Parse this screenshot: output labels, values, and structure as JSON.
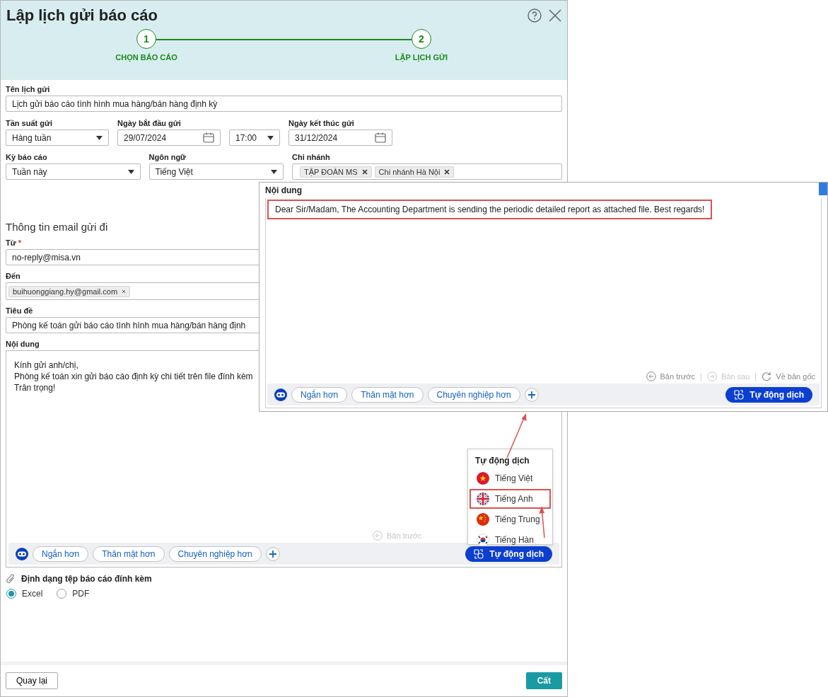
{
  "dialog": {
    "title": "Lập lịch gửi báo cáo"
  },
  "steps": [
    {
      "number": "1",
      "label": "CHỌN BÁO CÁO"
    },
    {
      "number": "2",
      "label": "LẬP LỊCH GỬI"
    }
  ],
  "schedule": {
    "name": {
      "label": "Tên lịch gửi",
      "value": "Lịch gửi báo cáo tình hình mua hàng/bán hàng định kỳ"
    },
    "frequency": {
      "label": "Tần suất gửi",
      "value": "Hàng tuần"
    },
    "start": {
      "label": "Ngày bắt đầu gửi",
      "date": "29/07/2024",
      "time": "17:00"
    },
    "end": {
      "label": "Ngày kết thúc gửi",
      "date": "31/12/2024"
    },
    "period": {
      "label": "Kỳ báo cáo",
      "value": "Tuần này"
    },
    "language": {
      "label": "Ngôn ngữ",
      "value": "Tiếng Việt"
    },
    "branch": {
      "label": "Chi nhánh",
      "tags": [
        "TẬP ĐOÀN MS",
        "Chi nhánh Hà Nội"
      ]
    }
  },
  "email": {
    "heading": "Thông tin email gửi đi",
    "from": {
      "label": "Từ",
      "required_mark": "*",
      "value": "no-reply@misa.vn"
    },
    "to": {
      "label": "Đến",
      "tags": [
        "buihuonggiang.hy@gmail.com"
      ]
    },
    "subject": {
      "label": "Tiêu đề",
      "value": "Phòng kế toán gửi báo cáo tình hình mua hàng/bán hàng định"
    },
    "content": {
      "label": "Nội dung",
      "lines": [
        "Kính gửi anh/chị,",
        "Phòng kế toán xin gửi báo cáo định kỳ chi tiết trên file đính kèm",
        "Trân trọng!"
      ],
      "nav": [
        {
          "label": "Bản trước",
          "kind": "back",
          "disabled": true
        }
      ],
      "chips": [
        "Ngắn hơn",
        "Thân mật hơn",
        "Chuyên nghiệp hơn"
      ],
      "translate_button": "Tự động dịch"
    }
  },
  "attachment": {
    "label": "Định dạng tệp báo cáo đính kèm",
    "options": [
      {
        "label": "Excel",
        "selected": true
      },
      {
        "label": "PDF",
        "selected": false
      }
    ]
  },
  "footer": {
    "back": "Quay lại",
    "save": "Cất"
  },
  "callout": {
    "label": "Nội dung",
    "text": "Dear Sir/Madam, The Accounting Department is sending the periodic detailed report as attached file. Best regards!",
    "highlighted": true,
    "nav": [
      {
        "label": "Bản trước",
        "kind": "back",
        "disabled": false
      },
      {
        "label": "Bản sau",
        "kind": "forward",
        "disabled": true
      },
      {
        "label": "Về bản gốc",
        "kind": "reset",
        "disabled": false
      }
    ],
    "chips": [
      "Ngắn hơn",
      "Thân mật hơn",
      "Chuyên nghiệp hơn"
    ],
    "translate_button": "Tự động dịch"
  },
  "translate_menu": {
    "title": "Tự động dịch",
    "items": [
      {
        "label": "Tiếng Việt",
        "kind": "vietnam",
        "selected": false
      },
      {
        "label": "Tiếng Anh",
        "kind": "uk",
        "selected": true
      },
      {
        "label": "Tiếng Trung",
        "kind": "china",
        "selected": false
      },
      {
        "label": "Tiếng Hàn",
        "kind": "korea",
        "selected": false
      }
    ]
  }
}
